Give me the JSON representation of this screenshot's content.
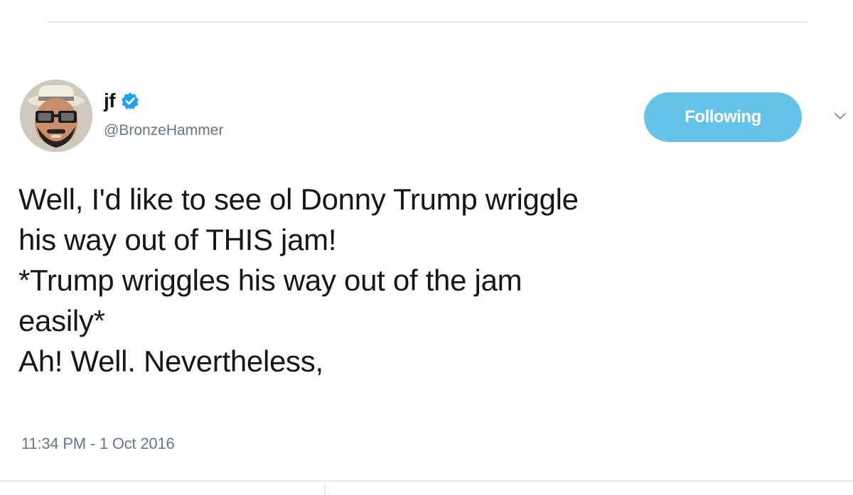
{
  "tweet": {
    "author": {
      "display_name": "jf",
      "handle": "@BronzeHammer",
      "verified": true,
      "avatar_icon": "bearded-man-sunglasses-avatar"
    },
    "follow_button_label": "Following",
    "menu_icon": "chevron-down-icon",
    "text_lines": [
      "Well, I'd like to see ol Donny Trump wriggle",
      "his way out of THIS jam!",
      "*Trump wriggles his way out of the jam",
      "easily*",
      "Ah! Well. Nevertheless,"
    ],
    "timestamp": "11:34 PM - 1 Oct 2016"
  },
  "colors": {
    "follow_button": "#66c3e8",
    "verified_badge": "#1da1f2",
    "secondary_text": "#657786",
    "divider": "#e6ecf0"
  }
}
